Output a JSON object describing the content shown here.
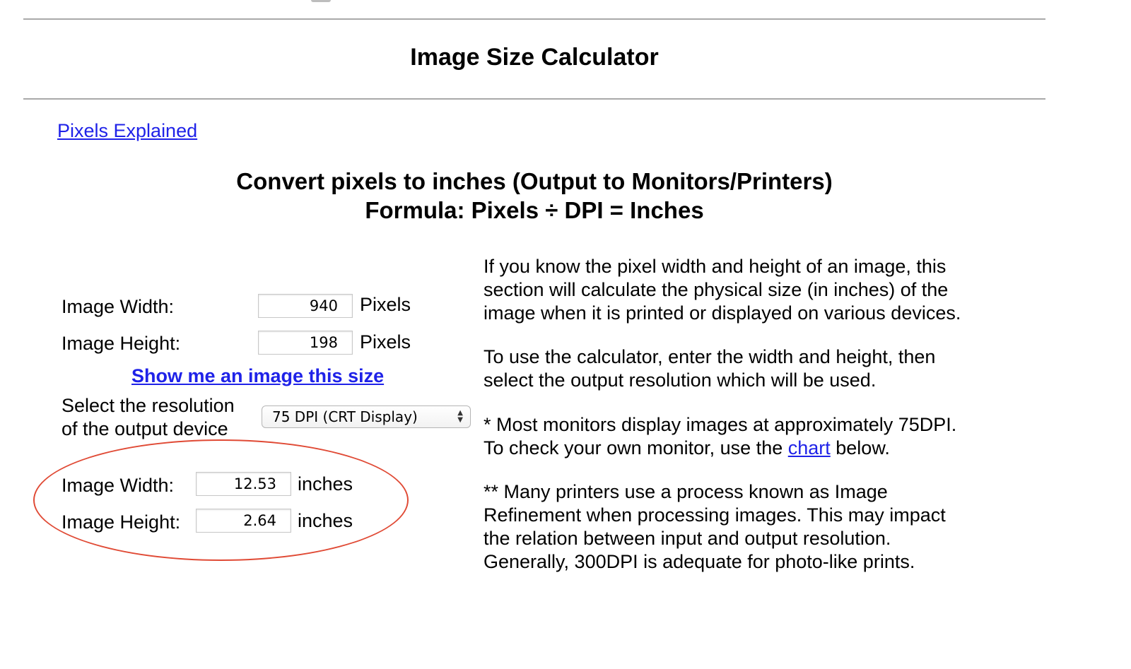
{
  "header": {
    "title": "Image Size Calculator"
  },
  "nav": {
    "pixels_explained": "Pixels Explained"
  },
  "section": {
    "title_line1": "Convert pixels to inches (Output to Monitors/Printers)",
    "title_line2": "Formula: Pixels ÷ DPI = Inches"
  },
  "inputs": {
    "width_label": "Image Width:",
    "width_value": "940",
    "width_unit": "Pixels",
    "height_label": "Image Height:",
    "height_value": "198",
    "height_unit": "Pixels"
  },
  "show_image_link": "Show me an image this size",
  "resolution": {
    "label_line1": "Select the resolution",
    "label_line2": "of the output device",
    "selected": "75 DPI (CRT Display)"
  },
  "outputs": {
    "width_label": "Image Width:",
    "width_value": "12.53",
    "width_unit": "inches",
    "height_label": "Image Height:",
    "height_value": "2.64",
    "height_unit": "inches"
  },
  "help": {
    "p1": [
      "If you know the pixel width and height of an image, this",
      "section will calculate the physical size (in inches) of the",
      "image when it is printed or displayed on various devices."
    ],
    "p2": [
      "To use the calculator, enter the width and height, then",
      "select the output resolution which will be used."
    ],
    "p3_line1": "* Most monitors display images at approximately 75DPI.",
    "p3_line2_before": "To check your own monitor, use the ",
    "p3_link": "chart",
    "p3_line2_after": " below.",
    "p4": [
      "** Many printers use a process known as Image",
      "Refinement when processing images. This may impact",
      "the relation between input and output resolution.",
      "Generally, 300DPI is adequate for photo-like prints."
    ]
  },
  "annotation": {
    "color": "#e04a35"
  }
}
